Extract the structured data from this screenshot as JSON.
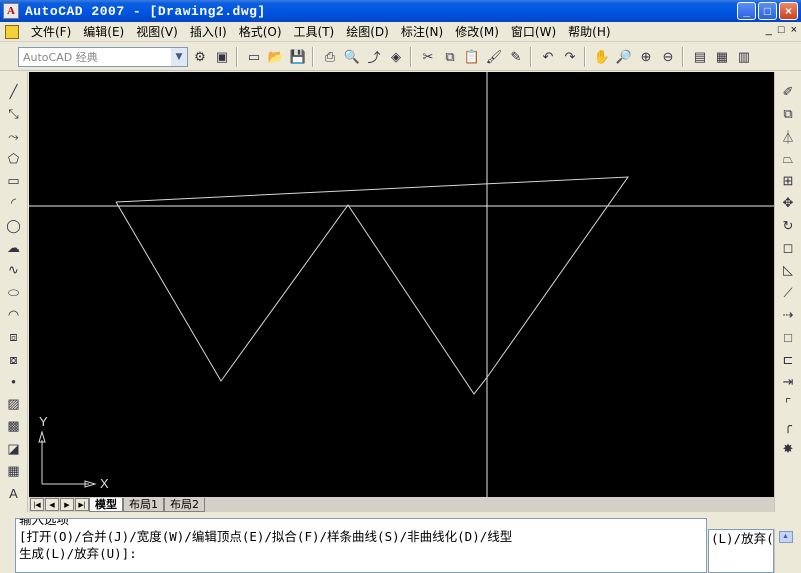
{
  "window": {
    "title": "AutoCAD 2007 - [Drawing2.dwg]",
    "app_icon_label": "A",
    "buttons": [
      "_",
      "□",
      "×"
    ]
  },
  "menubar": {
    "items": [
      {
        "label": "文件(F)",
        "id": "file"
      },
      {
        "label": "编辑(E)",
        "id": "edit"
      },
      {
        "label": "视图(V)",
        "id": "view"
      },
      {
        "label": "插入(I)",
        "id": "insert"
      },
      {
        "label": "格式(O)",
        "id": "format"
      },
      {
        "label": "工具(T)",
        "id": "tools"
      },
      {
        "label": "绘图(D)",
        "id": "draw"
      },
      {
        "label": "标注(N)",
        "id": "dimension"
      },
      {
        "label": "修改(M)",
        "id": "modify"
      },
      {
        "label": "窗口(W)",
        "id": "window"
      },
      {
        "label": "帮助(H)",
        "id": "help"
      }
    ],
    "mdi_buttons": [
      "_",
      "□",
      "×"
    ]
  },
  "toolbar": {
    "workspace": "AutoCAD 经典",
    "workspace_arrow": "▼",
    "icons": [
      {
        "name": "workspace-settings-icon",
        "glyph": "⚙"
      },
      {
        "name": "workspace-save-icon",
        "glyph": "▣"
      },
      {
        "sep": true
      },
      {
        "name": "new-icon",
        "glyph": "▭"
      },
      {
        "name": "open-icon",
        "glyph": "📂"
      },
      {
        "name": "save-icon",
        "glyph": "💾"
      },
      {
        "sep": true
      },
      {
        "name": "plot-icon",
        "glyph": "⎙"
      },
      {
        "name": "plot-preview-icon",
        "glyph": "🔍"
      },
      {
        "name": "publish-icon",
        "glyph": "⤴"
      },
      {
        "name": "3d-dwf-icon",
        "glyph": "◈"
      },
      {
        "sep": true
      },
      {
        "name": "cut-icon",
        "glyph": "✂"
      },
      {
        "name": "copy-icon",
        "glyph": "⧉"
      },
      {
        "name": "paste-icon",
        "glyph": "📋"
      },
      {
        "name": "match-properties-icon",
        "glyph": "🖌"
      },
      {
        "name": "block-editor-icon",
        "glyph": "✎"
      },
      {
        "sep": true
      },
      {
        "name": "undo-icon",
        "glyph": "↶"
      },
      {
        "name": "redo-icon",
        "glyph": "↷"
      },
      {
        "sep": true
      },
      {
        "name": "pan-icon",
        "glyph": "✋"
      },
      {
        "name": "zoom-realtime-icon",
        "glyph": "🔎"
      },
      {
        "name": "zoom-window-icon",
        "glyph": "⊕"
      },
      {
        "name": "zoom-previous-icon",
        "glyph": "⊖"
      },
      {
        "sep": true
      },
      {
        "name": "properties-icon",
        "glyph": "▤"
      },
      {
        "name": "design-center-icon",
        "glyph": "▦"
      },
      {
        "name": "tool-palettes-icon",
        "glyph": "▥"
      }
    ]
  },
  "draw_toolbar": [
    {
      "name": "line-icon",
      "glyph": "╱"
    },
    {
      "name": "construction-line-icon",
      "glyph": "⤡"
    },
    {
      "name": "polyline-icon",
      "glyph": "⤳"
    },
    {
      "name": "polygon-icon",
      "glyph": "⬠"
    },
    {
      "name": "rectangle-icon",
      "glyph": "▭"
    },
    {
      "name": "arc-icon",
      "glyph": "◜"
    },
    {
      "name": "circle-icon",
      "glyph": "◯"
    },
    {
      "name": "revision-cloud-icon",
      "glyph": "☁"
    },
    {
      "name": "spline-icon",
      "glyph": "∿"
    },
    {
      "name": "ellipse-icon",
      "glyph": "⬭"
    },
    {
      "name": "ellipse-arc-icon",
      "glyph": "◠"
    },
    {
      "name": "insert-block-icon",
      "glyph": "⧈"
    },
    {
      "name": "make-block-icon",
      "glyph": "⧇"
    },
    {
      "name": "point-icon",
      "glyph": "•"
    },
    {
      "name": "hatch-icon",
      "glyph": "▨"
    },
    {
      "name": "gradient-icon",
      "glyph": "▩"
    },
    {
      "name": "region-icon",
      "glyph": "◪"
    },
    {
      "name": "table-icon",
      "glyph": "▦"
    },
    {
      "name": "multiline-text-icon",
      "glyph": "A"
    }
  ],
  "modify_toolbar": [
    {
      "name": "erase-icon",
      "glyph": "✐"
    },
    {
      "name": "copy-object-icon",
      "glyph": "⧉"
    },
    {
      "name": "mirror-icon",
      "glyph": "⏃"
    },
    {
      "name": "offset-icon",
      "glyph": "⏢"
    },
    {
      "name": "array-icon",
      "glyph": "⊞"
    },
    {
      "name": "move-icon",
      "glyph": "✥"
    },
    {
      "name": "rotate-icon",
      "glyph": "↻"
    },
    {
      "name": "scale-icon",
      "glyph": "◻"
    },
    {
      "name": "stretch-icon",
      "glyph": "◺"
    },
    {
      "name": "trim-icon",
      "glyph": "⟋"
    },
    {
      "name": "extend-icon",
      "glyph": "⇢"
    },
    {
      "name": "break-at-point-icon",
      "glyph": "□"
    },
    {
      "name": "break-icon",
      "glyph": "⊏"
    },
    {
      "name": "join-icon",
      "glyph": "⇥"
    },
    {
      "name": "chamfer-icon",
      "glyph": "⌜"
    },
    {
      "name": "fillet-icon",
      "glyph": "╭"
    },
    {
      "name": "explode-icon",
      "glyph": "✸"
    }
  ],
  "canvas": {
    "ucs": {
      "x_label": "X",
      "y_label": "Y"
    }
  },
  "layout_tabs": {
    "nav": [
      "|◀",
      "◀",
      "▶",
      "▶|"
    ],
    "tabs": [
      {
        "label": "模型",
        "active": true
      },
      {
        "label": "布局1",
        "active": false
      },
      {
        "label": "布局2",
        "active": false
      }
    ]
  },
  "command": {
    "lines": [
      "输入选项",
      "[打开(O)/合并(J)/宽度(W)/编辑顶点(E)/拟合(F)/样条曲线(S)/非曲线化(D)/线型",
      "生成(L)/放弃(U)]:"
    ],
    "side_text": "(L)/放弃(U)",
    "scroll_arrow": "▲"
  },
  "colors": {
    "canvas_bg": "#000000",
    "geometry": "#d8d8d8",
    "crosshair": "#e8e8e8"
  }
}
